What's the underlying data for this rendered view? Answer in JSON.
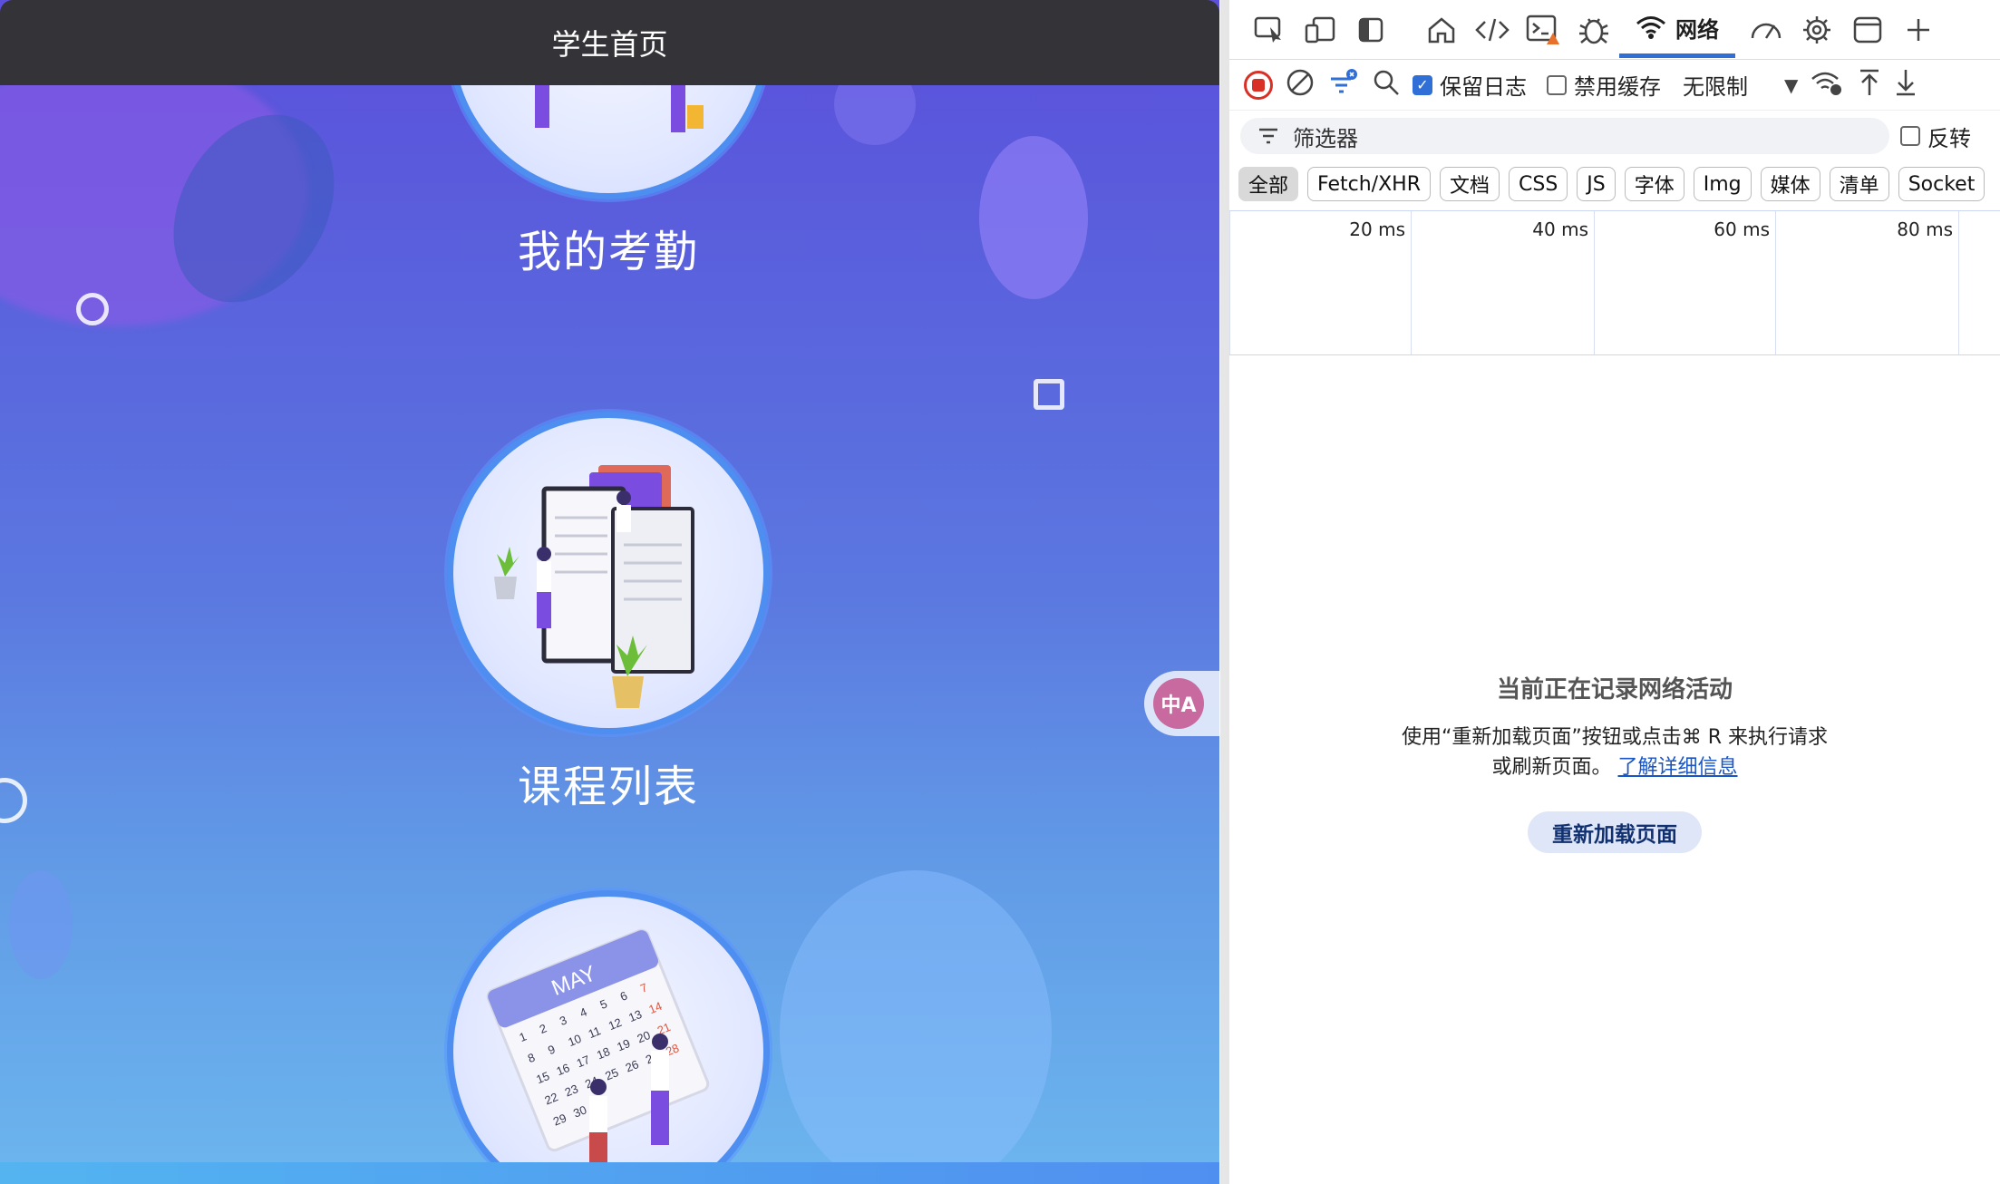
{
  "app": {
    "header_title": "学生首页",
    "features": [
      {
        "label": "我的考勤"
      },
      {
        "label": "课程列表"
      },
      {
        "label": ""
      }
    ],
    "calendar_month": "MAY",
    "translate_glyph": "中A"
  },
  "devtools": {
    "active_tab": "网络",
    "tool_icons": [
      "inspect-icon",
      "device-icon",
      "sidebar-icon",
      "home-icon",
      "code-icon",
      "console-icon",
      "bug-icon",
      "network-icon",
      "gauge-icon",
      "gear-icon",
      "window-icon",
      "plus-icon"
    ],
    "controls": {
      "preserve_log": "保留日志",
      "preserve_log_checked": true,
      "disable_cache": "禁用缓存",
      "disable_cache_checked": false,
      "throttle": "无限制"
    },
    "filter": {
      "placeholder": "筛选器",
      "invert_label": "反转"
    },
    "types": [
      "全部",
      "Fetch/XHR",
      "文档",
      "CSS",
      "JS",
      "字体",
      "Img",
      "媒体",
      "清单",
      "Socket"
    ],
    "timeline_ticks": [
      "20 ms",
      "40 ms",
      "60 ms",
      "80 ms"
    ],
    "empty_state": {
      "title": "当前正在记录网络活动",
      "line1": "使用“重新加载页面”按钮或点击⌘ R 来执行请求",
      "line2": "或刷新页面。",
      "link": "了解详细信息",
      "button": "重新加载页面"
    }
  }
}
